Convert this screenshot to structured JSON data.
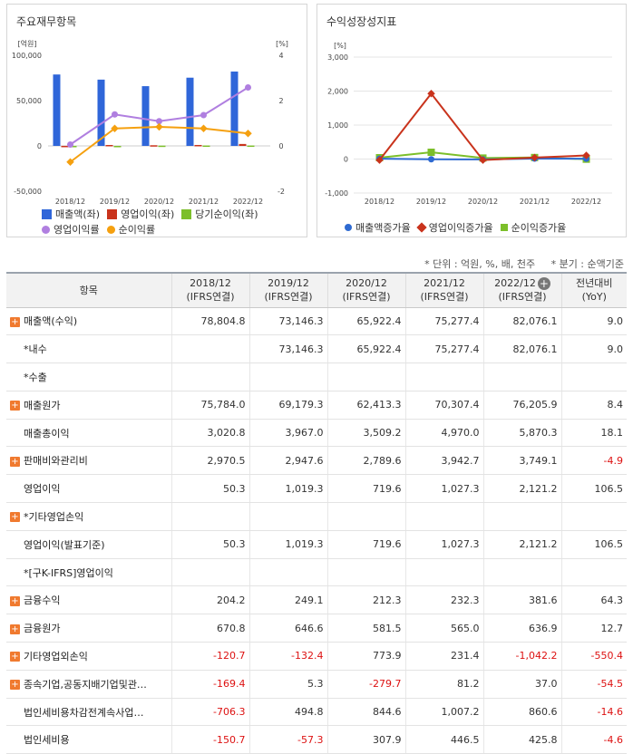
{
  "panel_left": {
    "title": "주요재무항목"
  },
  "panel_right": {
    "title": "수익성장성지표"
  },
  "chart_data": [
    {
      "type": "bar",
      "title": "주요재무항목",
      "categories": [
        "2018/12",
        "2019/12",
        "2020/12",
        "2021/12",
        "2022/12"
      ],
      "left_axis": {
        "unit": "[억원]",
        "ticks": [
          "100,000",
          "50,000",
          "0",
          "-50,000"
        ],
        "range": [
          -50000,
          100000
        ]
      },
      "right_axis": {
        "unit": "[%]",
        "ticks": [
          "4",
          "2",
          "0",
          "-2"
        ],
        "range": [
          -2,
          4
        ]
      },
      "series": [
        {
          "name": "매출액(좌)",
          "type": "bar",
          "axis": "left",
          "color": "#2f66d9",
          "values": [
            78804.8,
            73146.3,
            65922.4,
            75277.4,
            82076.1
          ]
        },
        {
          "name": "영업이익(좌)",
          "type": "bar",
          "axis": "left",
          "color": "#c9331c",
          "values": [
            50.3,
            1019.3,
            719.6,
            1027.3,
            2121.2
          ]
        },
        {
          "name": "당기순이익(좌)",
          "type": "bar",
          "axis": "left",
          "color": "#7cbf2a",
          "values": [
            -150.7,
            -57.3,
            307.9,
            446.5,
            425.8
          ]
        },
        {
          "name": "영업이익률",
          "type": "line",
          "axis": "right",
          "color": "#b07fe0",
          "values": [
            0.06,
            1.39,
            1.09,
            1.36,
            2.58
          ]
        },
        {
          "name": "순이익률",
          "type": "line",
          "axis": "right",
          "color": "#f5a00f",
          "values": [
            -0.71,
            0.77,
            0.84,
            0.77,
            0.55
          ]
        }
      ]
    },
    {
      "type": "line",
      "title": "수익성장성지표",
      "categories": [
        "2018/12",
        "2019/12",
        "2020/12",
        "2021/12",
        "2022/12"
      ],
      "y_axis": {
        "unit": "[%]",
        "ticks": [
          "3,000",
          "2,000",
          "1,000",
          "0",
          "-1,000"
        ],
        "range": [
          -1000,
          3000
        ]
      },
      "series": [
        {
          "name": "매출액증가율",
          "color": "#2e6ad1",
          "values": [
            10,
            -7.2,
            -9.9,
            14.2,
            9.0
          ]
        },
        {
          "name": "영업이익증가율",
          "color": "#c9331c",
          "values": [
            -30,
            1926.4,
            -29.4,
            42.8,
            106.5
          ]
        },
        {
          "name": "순이익증가율",
          "color": "#7cbf2a",
          "values": [
            40,
            200,
            30,
            45,
            -4.6
          ]
        }
      ]
    }
  ],
  "note": {
    "left": "* 단위 : 억원, %, 배, 천주",
    "right": "* 분기 : 순액기준"
  },
  "table": {
    "headers": [
      {
        "l1": "항목",
        "l2": ""
      },
      {
        "l1": "2018/12",
        "l2": "(IFRS연결)"
      },
      {
        "l1": "2019/12",
        "l2": "(IFRS연결)"
      },
      {
        "l1": "2020/12",
        "l2": "(IFRS연결)"
      },
      {
        "l1": "2021/12",
        "l2": "(IFRS연결)"
      },
      {
        "l1": "2022/12",
        "l2": "(IFRS연결)"
      },
      {
        "l1": "전년대비",
        "l2": "(YoY)"
      }
    ],
    "rows": [
      {
        "label": "매출액(수익)",
        "expand": true,
        "v": [
          "78,804.8",
          "73,146.3",
          "65,922.4",
          "75,277.4",
          "82,076.1",
          "9.0"
        ]
      },
      {
        "label": "*내수",
        "expand": false,
        "v": [
          "",
          "73,146.3",
          "65,922.4",
          "75,277.4",
          "82,076.1",
          "9.0"
        ]
      },
      {
        "label": "*수출",
        "expand": false,
        "v": [
          "",
          "",
          "",
          "",
          "",
          ""
        ]
      },
      {
        "label": "매출원가",
        "expand": true,
        "v": [
          "75,784.0",
          "69,179.3",
          "62,413.3",
          "70,307.4",
          "76,205.9",
          "8.4"
        ]
      },
      {
        "label": "매출총이익",
        "expand": false,
        "v": [
          "3,020.8",
          "3,967.0",
          "3,509.2",
          "4,970.0",
          "5,870.3",
          "18.1"
        ]
      },
      {
        "label": "판매비와관리비",
        "expand": true,
        "v": [
          "2,970.5",
          "2,947.6",
          "2,789.6",
          "3,942.7",
          "3,749.1",
          "-4.9"
        ]
      },
      {
        "label": "영업이익",
        "expand": false,
        "v": [
          "50.3",
          "1,019.3",
          "719.6",
          "1,027.3",
          "2,121.2",
          "106.5"
        ]
      },
      {
        "label": "*기타영업손익",
        "expand": true,
        "v": [
          "",
          "",
          "",
          "",
          "",
          ""
        ]
      },
      {
        "label": "영업이익(발표기준)",
        "expand": false,
        "v": [
          "50.3",
          "1,019.3",
          "719.6",
          "1,027.3",
          "2,121.2",
          "106.5"
        ]
      },
      {
        "label": "*[구K-IFRS]영업이익",
        "expand": false,
        "v": [
          "",
          "",
          "",
          "",
          "",
          ""
        ]
      },
      {
        "label": "금융수익",
        "expand": true,
        "v": [
          "204.2",
          "249.1",
          "212.3",
          "232.3",
          "381.6",
          "64.3"
        ]
      },
      {
        "label": "금융원가",
        "expand": true,
        "v": [
          "670.8",
          "646.6",
          "581.5",
          "565.0",
          "636.9",
          "12.7"
        ]
      },
      {
        "label": "기타영업외손익",
        "expand": true,
        "v": [
          "-120.7",
          "-132.4",
          "773.9",
          "231.4",
          "-1,042.2",
          "-550.4"
        ]
      },
      {
        "label": "종속기업,공동지배기업및관…",
        "expand": true,
        "v": [
          "-169.4",
          "5.3",
          "-279.7",
          "81.2",
          "37.0",
          "-54.5"
        ]
      },
      {
        "label": "법인세비용차감전계속사업…",
        "expand": false,
        "v": [
          "-706.3",
          "494.8",
          "844.6",
          "1,007.2",
          "860.6",
          "-14.6"
        ]
      },
      {
        "label": "법인세비용",
        "expand": false,
        "v": [
          "-150.7",
          "-57.3",
          "307.9",
          "446.5",
          "425.8",
          "-4.6"
        ]
      }
    ]
  }
}
